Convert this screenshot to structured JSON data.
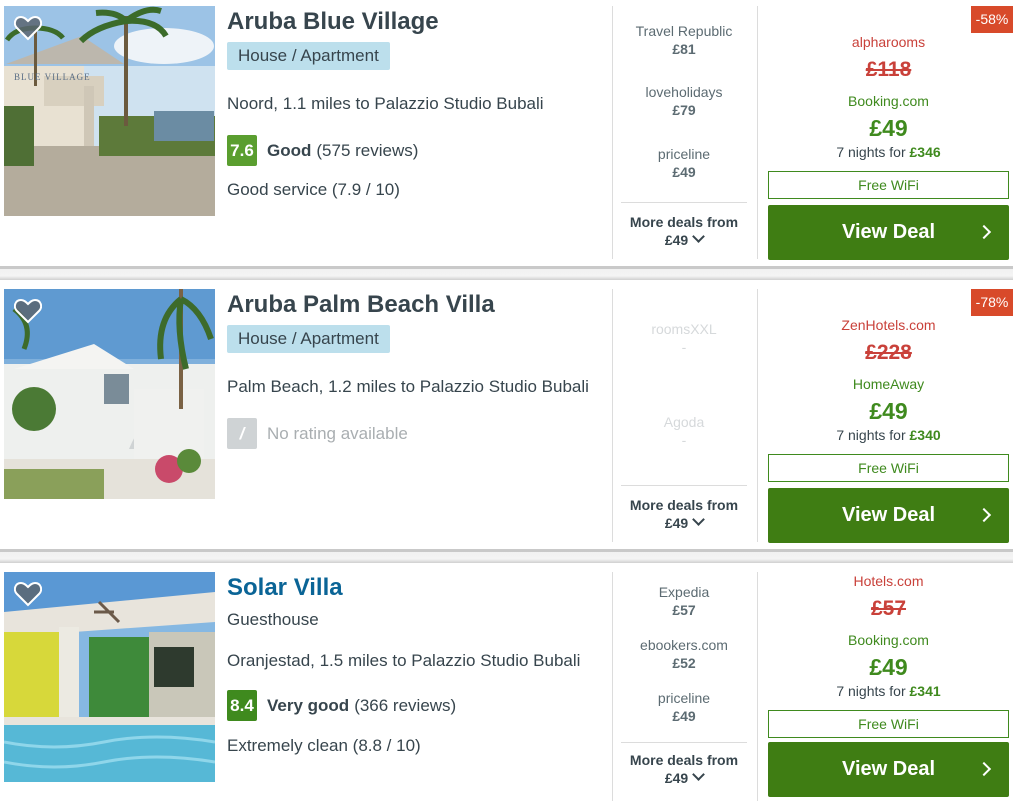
{
  "hotels": [
    {
      "name": "Aruba Blue Village",
      "type": "House / Apartment",
      "location": "Noord, 1.1 miles to Palazzio Studio Bubali",
      "score": "7.6",
      "rating_word": "Good",
      "reviews": "(575 reviews)",
      "subrating": "Good service (7.9 / 10)",
      "deals": [
        {
          "provider": "Travel Republic",
          "price": "£81"
        },
        {
          "provider": "loveholidays",
          "price": "£79"
        },
        {
          "provider": "priceline",
          "price": "£49"
        }
      ],
      "more_label": "More deals from",
      "more_price": "£49",
      "discount": "-58%",
      "old_provider": "alpharooms",
      "old_price": "£118",
      "best_provider": "Booking.com",
      "best_price": "£49",
      "nights_text": "7 nights for",
      "nights_total": "£346",
      "amenity": "Free WiFi",
      "cta": "View Deal"
    },
    {
      "name": "Aruba Palm Beach Villa",
      "type": "House / Apartment",
      "location": "Palm Beach, 1.2 miles to Palazzio Studio Bubali",
      "score": "/",
      "rating_word": "No rating available",
      "deals": [
        {
          "provider": "roomsXXL",
          "price": "-"
        },
        {
          "provider": "Agoda",
          "price": "-"
        }
      ],
      "more_label": "More deals from",
      "more_price": "£49",
      "discount": "-78%",
      "old_provider": "ZenHotels.com",
      "old_price": "£228",
      "best_provider": "HomeAway",
      "best_price": "£49",
      "nights_text": "7 nights for",
      "nights_total": "£340",
      "amenity": "Free WiFi",
      "cta": "View Deal"
    },
    {
      "name": "Solar Villa",
      "type": "Guesthouse",
      "location": "Oranjestad, 1.5 miles to Palazzio Studio Bubali",
      "score": "8.4",
      "rating_word": "Very good",
      "reviews": "(366 reviews)",
      "subrating": "Extremely clean (8.8 / 10)",
      "deals": [
        {
          "provider": "Expedia",
          "price": "£57"
        },
        {
          "provider": "ebookers.com",
          "price": "£52"
        },
        {
          "provider": "priceline",
          "price": "£49"
        }
      ],
      "more_label": "More deals from",
      "more_price": "£49",
      "old_provider": "Hotels.com",
      "old_price": "£57",
      "best_provider": "Booking.com",
      "best_price": "£49",
      "nights_text": "7 nights for",
      "nights_total": "£341",
      "amenity": "Free WiFi",
      "cta": "View Deal"
    }
  ],
  "photo_lettering": "BLUE VILLAGE",
  "icons": [
    "heart-icon",
    "chevron-down-icon",
    "chevron-right-icon"
  ],
  "colors": {
    "deal_green": "#3f7d13",
    "discount_red": "#d84a2a",
    "badge_blue": "#bcdfec"
  }
}
